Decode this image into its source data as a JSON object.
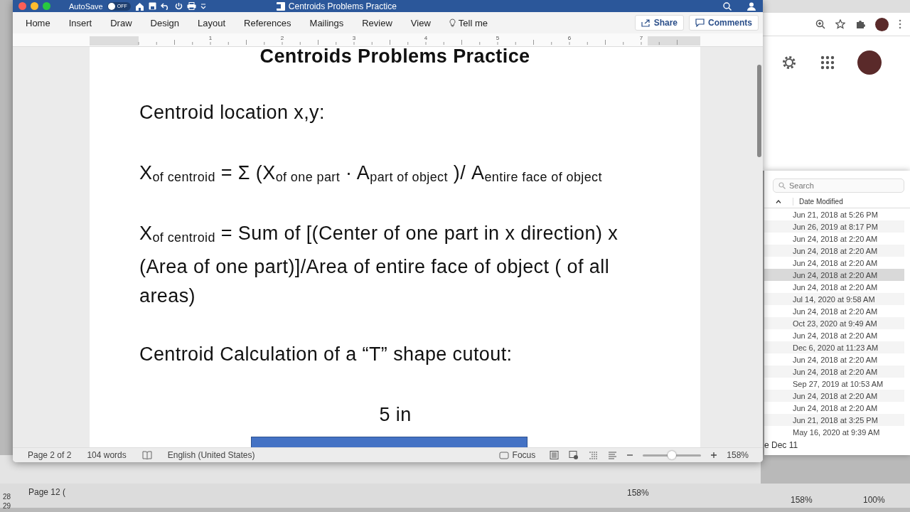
{
  "word": {
    "title_bar": {
      "autosave_label": "AutoSave",
      "autosave_toggle": {
        "on": false,
        "label": "OFF"
      },
      "title": "Centroids Problems Practice"
    },
    "tabs": [
      {
        "label": "Home",
        "kind": "tab"
      },
      {
        "label": "Insert",
        "kind": "tab"
      },
      {
        "label": "Draw",
        "kind": "tab"
      },
      {
        "label": "Design",
        "kind": "tab"
      },
      {
        "label": "Layout",
        "kind": "tab"
      },
      {
        "label": "References",
        "kind": "tab"
      },
      {
        "label": "Mailings",
        "kind": "tab"
      },
      {
        "label": "Review",
        "kind": "tab"
      },
      {
        "label": "View",
        "kind": "tab"
      },
      {
        "label": "Tell me",
        "kind": "search"
      }
    ],
    "actions": [
      {
        "label": "Share",
        "kind": "share"
      },
      {
        "label": "Comments",
        "kind": "comments"
      }
    ],
    "ruler_numbers": [
      "1",
      "2",
      "3",
      "4",
      "5",
      "6",
      "7"
    ],
    "document": {
      "title": "Centroids Problems Practice",
      "blocks": [
        {
          "kind": "heading",
          "text": "Centroid location x,y:"
        },
        {
          "kind": "formula",
          "text": "X$_{of centroid}$ = Σ (X$_{of one part}$ · A$_{part of object}$ )/ A$_{entire face of object}$"
        },
        {
          "kind": "paragraph",
          "text": "X$_{of centroid}$ = Sum of [(Center of one part in x direction) x (Area of one part)]/Area of entire face of object ( of all areas)"
        },
        {
          "kind": "heading",
          "text": "Centroid Calculation of a “T” shape cutout:"
        },
        {
          "kind": "dimension",
          "text": "5 in"
        },
        {
          "kind": "shape"
        }
      ]
    },
    "status_bar": {
      "page": "Page 2 of 2",
      "words": "104 words",
      "language": "English (United States)",
      "focus": "Focus",
      "zoom": {
        "level": 0.5
      },
      "zoom_reading": "158%"
    }
  },
  "finder": {
    "search": {
      "placeholder": "Search"
    },
    "column": "Date Modified",
    "rows": [
      {
        "date": "Jun 21, 2018 at 5:26 PM",
        "selected": false
      },
      {
        "date": "Jun 26, 2019 at 8:17 PM",
        "selected": false
      },
      {
        "date": "Jun 24, 2018 at 2:20 AM",
        "selected": false
      },
      {
        "date": "Jun 24, 2018 at 2:20 AM",
        "selected": false
      },
      {
        "date": "Jun 24, 2018 at 2:20 AM",
        "selected": false
      },
      {
        "date": "Jun 24, 2018 at 2:20 AM",
        "selected": true
      },
      {
        "date": "Jun 24, 2018 at 2:20 AM",
        "selected": false
      },
      {
        "date": "Jul 14, 2020 at 9:58 AM",
        "selected": false
      },
      {
        "date": "Jun 24, 2018 at 2:20 AM",
        "selected": false
      },
      {
        "date": "Oct 23, 2020 at 9:49 AM",
        "selected": false
      },
      {
        "date": "Jun 24, 2018 at 2:20 AM",
        "selected": false
      },
      {
        "date": "Dec 6, 2020 at 11:23 AM",
        "selected": false
      },
      {
        "date": "Jun 24, 2018 at 2:20 AM",
        "selected": false
      },
      {
        "date": "Jun 24, 2018 at 2:20 AM",
        "selected": false
      },
      {
        "date": "Sep 27, 2019 at 10:53 AM",
        "selected": false
      },
      {
        "date": "Jun 24, 2018 at 2:20 AM",
        "selected": false
      },
      {
        "date": "Jun 24, 2018 at 2:20 AM",
        "selected": false
      },
      {
        "date": "Jun 21, 2018 at 3:25 PM",
        "selected": false
      },
      {
        "date": "May 16, 2020 at 9:39 AM",
        "selected": false
      }
    ],
    "footer": "e Dec 11"
  },
  "background": {
    "page_label": "Page 12 (",
    "line_numbers": [
      "28",
      "29"
    ],
    "zoom_readings": [
      "158%",
      "158%",
      "100%"
    ]
  }
}
